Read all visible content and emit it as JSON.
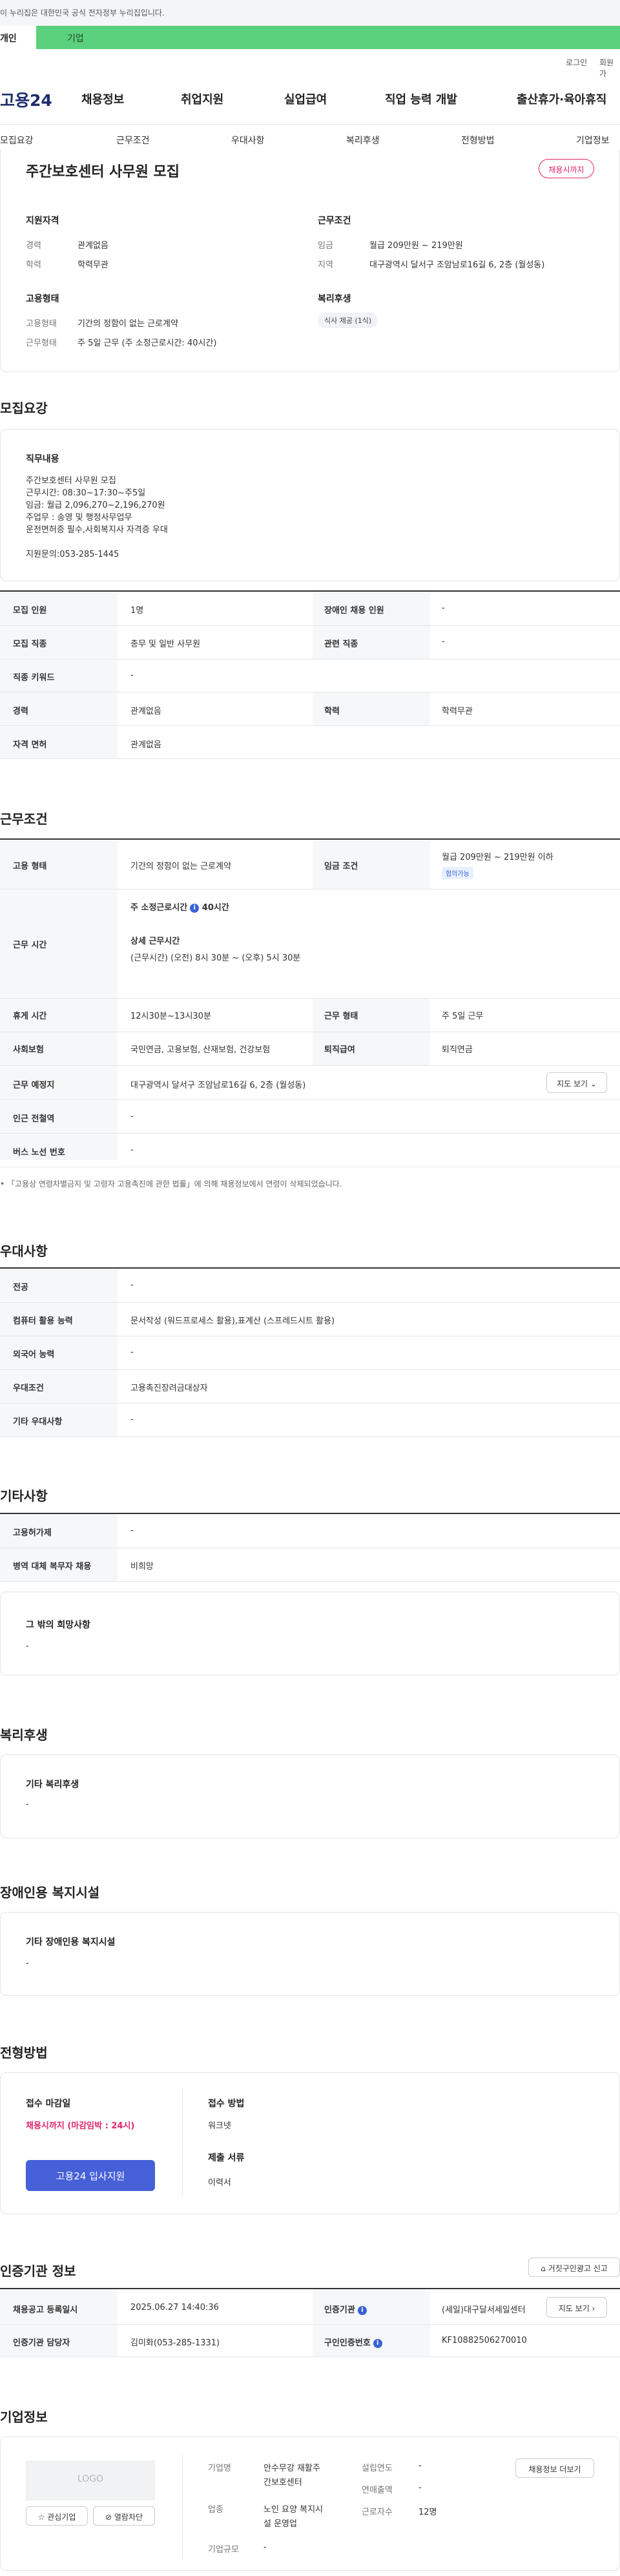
{
  "gov_bar": {
    "text": "이 누리집은 대한민국 공식 전자정부 누리집입니다."
  },
  "service_tabs": {
    "personal": "개인",
    "company": "기업"
  },
  "util": {
    "login": "로그인",
    "signup": "회원가"
  },
  "logo": {
    "text": "고용24"
  },
  "gnb": [
    "채용정보",
    "취업지원",
    "실업급여",
    "직업 능력 개발",
    "출산휴가·육아휴직"
  ],
  "subnav": [
    "모집요강",
    "근무조건",
    "우대사항",
    "복리후생",
    "전형방법",
    "기업정보"
  ],
  "summary": {
    "title": "주간보호센터 사무원 모집",
    "deadline_badge": "채용시까지",
    "qual_heading": "지원자격",
    "career_label": "경력",
    "career_value": "관계없음",
    "edu_label": "학력",
    "edu_value": "학력무관",
    "cond_heading": "근무조건",
    "wage_label": "임금",
    "wage_value": "월급 209만원 ~ 219만원",
    "region_label": "지역",
    "region_value": "대구광역시 달서구 조암남로16길 6, 2층 (월성동)",
    "emp_heading": "고용형태",
    "emp_type_label": "고용형태",
    "emp_type_value": "기간의 정함이 없는 근로계약",
    "work_type_label": "근무형태",
    "work_type_value": "주 5일 근무 (주 소정근로시간: 40시간)",
    "welfare_heading": "복리후생",
    "welfare_chip": "식사 제공 (1식)"
  },
  "recruit": {
    "section_title": "모집요강",
    "duty_heading": "직무내용",
    "duty_lines": [
      "주간보호센터 사무원 모집",
      "근무시간: 08:30~17:30~주5일",
      "임금: 월급 2,096,270~2,196,270원",
      "주업무 : 송영 및 행정사무업무",
      "운전면허증 필수,사회복지사 자격증 우대",
      "",
      "지원문의:053-285-1445"
    ],
    "rows": [
      {
        "k1": "모집 인원",
        "v1": "1명",
        "k2": "장애인 채용 인원",
        "v2": "-"
      },
      {
        "k1": "모집 직종",
        "v1": "총무 및 일반 사무원",
        "k2": "관련 직종",
        "v2": "-"
      },
      {
        "k1": "직종 키워드",
        "v1": "-"
      },
      {
        "k1": "경력",
        "v1": "관계없음",
        "k2": "학력",
        "v2": "학력무관"
      },
      {
        "k1": "자격 면허",
        "v1": "관계없음"
      }
    ]
  },
  "conditions": {
    "section_title": "근무조건",
    "emp_type_label": "고용 형태",
    "emp_type_value": "기간의 정함이 없는 근로계약",
    "wage_label": "임금 조건",
    "wage_value": "월급 209만원 ~ 219만원 이하",
    "wage_badge": "협의가능",
    "worktime_label": "근무 시간",
    "worktime_weekly": "주 소정근로시간",
    "worktime_hours": "40시간",
    "worktime_detail_title": "상세 근무시간",
    "worktime_detail": "(근무시간) (오전) 8시 30분 ~ (오후) 5시 30분",
    "break_label": "휴게 시간",
    "break_value": "12시30분~13시30분",
    "work_form_label": "근무 형태",
    "work_form_value": "주 5일 근무",
    "insurance_label": "사회보험",
    "insurance_value": "국민연금, 고용보험, 산재보험, 건강보험",
    "retire_label": "퇴직급여",
    "retire_value": "퇴직연금",
    "location_label": "근무 예정지",
    "location_value": "대구광역시 달서구 조암남로16길 6, 2층 (월성동)",
    "map_button": "지도 보기",
    "subway_label": "인근 전철역",
    "subway_value": "-",
    "bus_label": "버스 노선 번호",
    "bus_value": "-",
    "note": "「고용상 연령차별금지 및 고령자 고용촉진에 관한 법률」에 의해 채용정보에서 연령이 삭제되었습니다."
  },
  "preferences": {
    "section_title": "우대사항",
    "rows": [
      {
        "k": "전공",
        "v": "-"
      },
      {
        "k": "컴퓨터 활용 능력",
        "v": "문서작성 (워드프로세스 활용),표계산 (스프레드시트 활용)"
      },
      {
        "k": "외국어 능력",
        "v": "-"
      },
      {
        "k": "우대조건",
        "v": "고용촉진장려금대상자"
      },
      {
        "k": "기타 우대사항",
        "v": "-"
      }
    ]
  },
  "etc": {
    "section_title": "기타사항",
    "rows": [
      {
        "k": "고용허가제",
        "v": "-"
      },
      {
        "k": "병역 대체 복무자 채용",
        "v": "비희망"
      }
    ],
    "other_heading": "그 밖의 희망사항",
    "other_value": "-"
  },
  "welfare": {
    "section_title": "복리후생",
    "heading": "기타 복리후생",
    "value": "-"
  },
  "disability": {
    "section_title": "장애인용 복지시설",
    "heading": "기타 장애인용 복지시설",
    "value": "-"
  },
  "selection": {
    "section_title": "전형방법",
    "deadline_label": "접수 마감일",
    "deadline_value": "채용시까지 (마감임박 : 24시)",
    "apply_button": "고용24 입사지원",
    "method_label": "접수 방법",
    "method_value": "워크넷",
    "docs_label": "제출 서류",
    "docs_value": "이력서"
  },
  "agency": {
    "section_title": "인증기관 정보",
    "report_button": "거짓구인광고 신고",
    "reg_date_label": "채용공고 등록일시",
    "reg_date_value": "2025.06.27 14:40:36",
    "org_label": "인증기관",
    "org_value": "(세일)대구달서세일센터",
    "map_button": "지도 보기",
    "manager_label": "인증기관 담당자",
    "manager_value": "김미화(053-285-1331)",
    "job_no_label": "구인인증번호",
    "job_no_value": "KF10882506270010"
  },
  "company": {
    "section_title": "기업정보",
    "logo_placeholder": "LOGO",
    "fav_button": "관심기업",
    "block_button": "열람차단",
    "name_label": "기업명",
    "name_line1": "안수무강 재활주",
    "name_line2": "간보호센터",
    "industry_label": "업종",
    "industry_line1": "노인 요양 복지시",
    "industry_line2": "설 운영업",
    "size_label": "기업규모",
    "size_value": "-",
    "founded_label": "설립연도",
    "founded_value": "-",
    "sales_label": "연매출액",
    "sales_value": "-",
    "employees_label": "근로자수",
    "employees_value": "12명",
    "jobs_button": "채용정보 더보기"
  }
}
